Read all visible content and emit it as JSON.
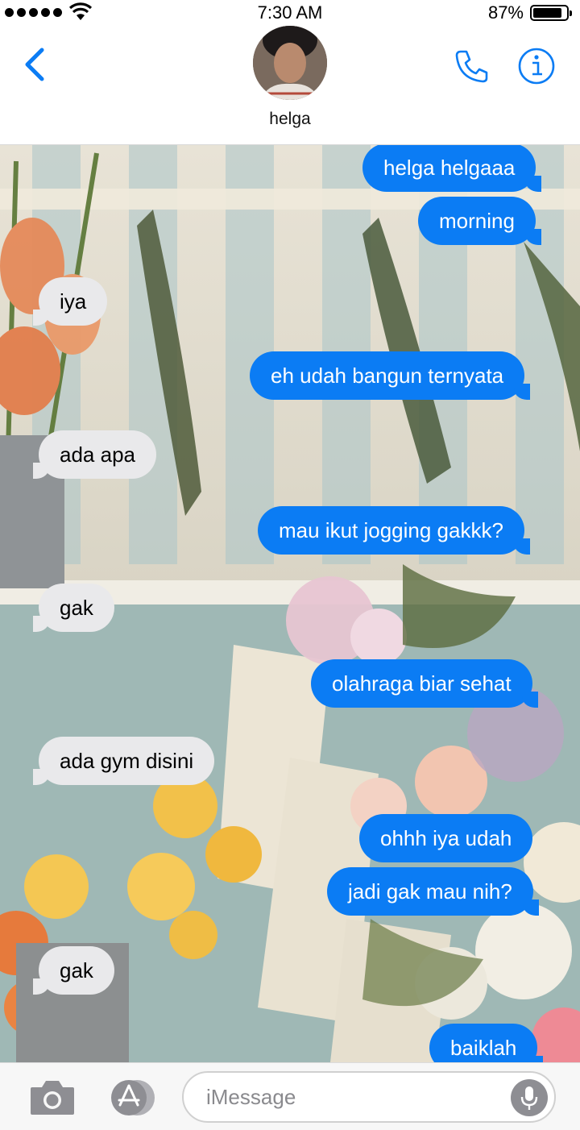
{
  "status_bar": {
    "time": "7:30 AM",
    "battery_percent": "87%",
    "battery_level": 0.87
  },
  "header": {
    "contact_name": "helga"
  },
  "messages": [
    {
      "text": "helga helgaaa",
      "direction": "outgoing"
    },
    {
      "text": "morning",
      "direction": "outgoing"
    },
    {
      "text": "iya",
      "direction": "incoming"
    },
    {
      "text": "eh udah bangun ternyata",
      "direction": "outgoing"
    },
    {
      "text": "ada apa",
      "direction": "incoming"
    },
    {
      "text": "mau ikut jogging gakkk?",
      "direction": "outgoing"
    },
    {
      "text": "gak",
      "direction": "incoming"
    },
    {
      "text": "olahraga biar sehat",
      "direction": "outgoing"
    },
    {
      "text": "ada gym disini",
      "direction": "incoming"
    },
    {
      "text": "ohhh iya udah",
      "direction": "outgoing"
    },
    {
      "text": "jadi gak mau nih?",
      "direction": "outgoing"
    },
    {
      "text": "gak",
      "direction": "incoming"
    },
    {
      "text": "baiklah",
      "direction": "outgoing"
    }
  ],
  "input_bar": {
    "placeholder": "iMessage"
  },
  "colors": {
    "accent": "#0b7cf4",
    "incoming_bubble": "#e9e9eb",
    "outgoing_bubble": "#0b7cf4"
  },
  "icons": [
    "signal-icon",
    "wifi-icon",
    "battery-icon",
    "back-chevron-icon",
    "phone-icon",
    "info-icon",
    "camera-icon",
    "app-store-icon",
    "microphone-icon"
  ]
}
